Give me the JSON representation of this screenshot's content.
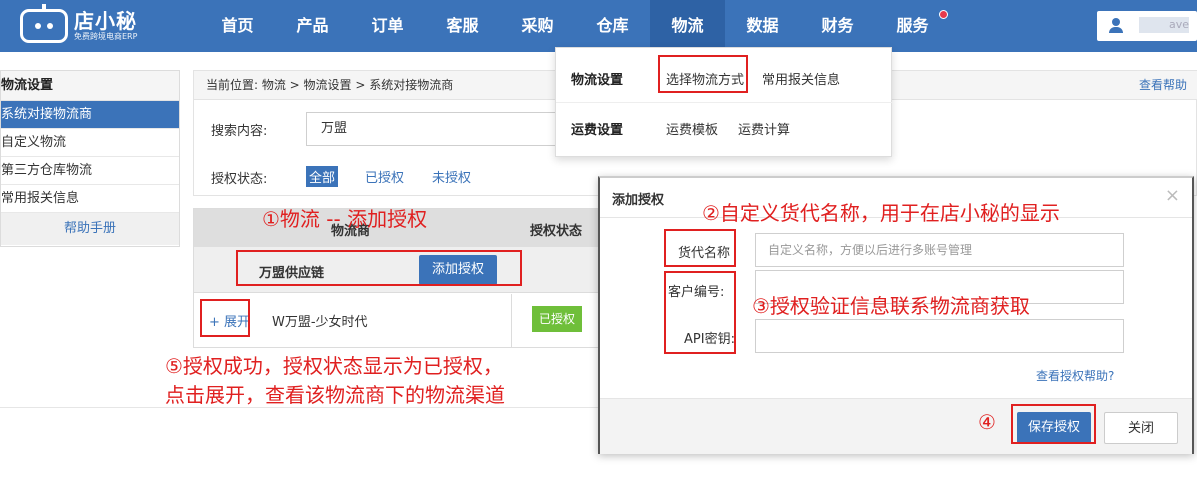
{
  "brand": {
    "name": "店小秘",
    "tagline": "免费跨境电商ERP"
  },
  "nav": [
    {
      "label": "首页"
    },
    {
      "label": "产品"
    },
    {
      "label": "订单"
    },
    {
      "label": "客服"
    },
    {
      "label": "采购"
    },
    {
      "label": "仓库"
    },
    {
      "label": "物流"
    },
    {
      "label": "数据"
    },
    {
      "label": "财务"
    },
    {
      "label": "服务"
    }
  ],
  "user": {
    "name": "ave"
  },
  "sidebar": {
    "title": "物流设置",
    "items": [
      {
        "label": "系统对接物流商"
      },
      {
        "label": "自定义物流"
      },
      {
        "label": "第三方仓库物流"
      },
      {
        "label": "常用报关信息"
      }
    ],
    "help": "帮助手册"
  },
  "breadcrumb": {
    "text": "当前位置:  物流 >  物流设置 > 系统对接物流商",
    "right": "查看帮助"
  },
  "search": {
    "label": "搜索内容:",
    "value": "万盟"
  },
  "auth_filter": {
    "label": "授权状态:",
    "options": [
      "全部",
      "已授权",
      "未授权"
    ]
  },
  "table": {
    "headers": [
      "物流商",
      "授权状态"
    ],
    "group": {
      "name": "万盟供应链",
      "add_button": "添加授权"
    },
    "row": {
      "expand": "+ 展开",
      "name": "W万盟-少女时代",
      "status": "已授权"
    }
  },
  "dropdown": {
    "rows": [
      {
        "head": "物流设置",
        "links": [
          "选择物流方式",
          "常用报关信息"
        ]
      },
      {
        "head": "运费设置",
        "links": [
          "运费模板",
          "运费计算"
        ]
      }
    ]
  },
  "modal": {
    "title": "添加授权",
    "close": "×",
    "fields": {
      "name_label": "货代名称",
      "name_placeholder": "自定义名称，方便以后进行多账号管理",
      "customer_label": "客户编号:",
      "api_label": "API密钥:"
    },
    "help_link": "查看授权帮助?",
    "save": "保存授权",
    "cancel": "关闭"
  },
  "annotations": {
    "a1": "①物流 -- 添加授权",
    "a2": "②自定义货代名称，用于在店小秘的显示",
    "a3": "③授权验证信息联系物流商获取",
    "a4": "④",
    "a5_line1": "⑤授权成功，授权状态显示为已授权，",
    "a5_line2": "点击展开，查看该物流商下的物流渠道"
  },
  "colors": {
    "primary": "#3b73b9",
    "annotation": "#e02020",
    "success": "#6fbf3a"
  }
}
